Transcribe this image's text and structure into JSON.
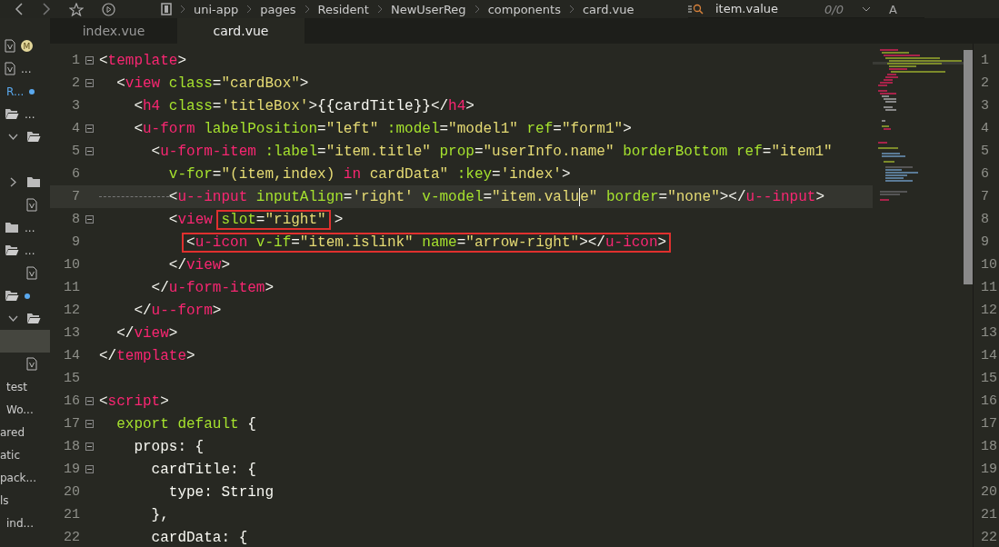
{
  "toolbar": {
    "breadcrumb": [
      "uni-app",
      "pages",
      "Resident",
      "NewUserReg",
      "components",
      "card.vue"
    ],
    "search": {
      "value": "item.value",
      "count": "0/0",
      "case_toggle": "A"
    }
  },
  "tabs": [
    {
      "label": "index.vue",
      "selected": false
    },
    {
      "label": "card.vue",
      "selected": true
    }
  ],
  "sidebar": {
    "items": [
      {
        "kind": "file",
        "badge": "M",
        "selected": false,
        "modified": false
      },
      {
        "kind": "file",
        "label": "...",
        "selected": false,
        "modified": false
      },
      {
        "kind": "label",
        "label": "R...",
        "selected": false,
        "modified": true
      },
      {
        "kind": "open-folder",
        "label": "...",
        "selected": false,
        "modified": false
      },
      {
        "kind": "expanded-folder",
        "selected": false,
        "modified": false
      },
      {
        "kind": "blank",
        "selected": false
      },
      {
        "kind": "collapsed-folder",
        "selected": false,
        "modified": false
      },
      {
        "kind": "nested-file",
        "selected": false,
        "modified": false
      },
      {
        "kind": "folder",
        "label": "...",
        "selected": false,
        "modified": false
      },
      {
        "kind": "open-folder",
        "label": "...",
        "selected": false,
        "modified": false
      },
      {
        "kind": "nested-file",
        "selected": false,
        "modified": false
      },
      {
        "kind": "open-folder",
        "selected": false,
        "modified": true
      },
      {
        "kind": "expanded-folder",
        "selected": false,
        "modified": false
      },
      {
        "kind": "blank",
        "selected": true
      },
      {
        "kind": "nested-file",
        "selected": false,
        "modified": false
      },
      {
        "kind": "text",
        "label": "test",
        "selected": false
      },
      {
        "kind": "text",
        "label": "Wo...",
        "selected": false
      },
      {
        "kind": "cut-text",
        "label": "ared",
        "selected": false
      },
      {
        "kind": "cut-text",
        "label": "atic",
        "selected": false
      },
      {
        "kind": "cut-text",
        "label": "pack...",
        "selected": false
      },
      {
        "kind": "cut-text",
        "label": "ls",
        "selected": false
      },
      {
        "kind": "text",
        "label": "ind...",
        "selected": false
      }
    ]
  },
  "editor": {
    "lines": [
      {
        "number": "1",
        "fold": true,
        "current": false,
        "tokens": [
          {
            "kind": "punct",
            "text": "<"
          },
          {
            "kind": "tag",
            "text": "template"
          },
          {
            "kind": "punct",
            "text": ">"
          }
        ]
      },
      {
        "number": "2",
        "fold": true,
        "current": false,
        "tokens": [
          {
            "kind": "punct",
            "text": "  <"
          },
          {
            "kind": "tag",
            "text": "view"
          },
          {
            "kind": "attr",
            "text": " class"
          },
          {
            "kind": "punct",
            "text": "="
          },
          {
            "kind": "string",
            "text": "\"cardBox\""
          },
          {
            "kind": "punct",
            "text": ">"
          }
        ]
      },
      {
        "number": "3",
        "fold": false,
        "current": false,
        "tokens": [
          {
            "kind": "punct",
            "text": "    <"
          },
          {
            "kind": "tag",
            "text": "h4"
          },
          {
            "kind": "attr",
            "text": " class"
          },
          {
            "kind": "punct",
            "text": "="
          },
          {
            "kind": "string",
            "text": "'titleBox'"
          },
          {
            "kind": "punct",
            "text": ">{{cardTitle}}</"
          },
          {
            "kind": "tag",
            "text": "h4"
          },
          {
            "kind": "punct",
            "text": ">"
          }
        ]
      },
      {
        "number": "4",
        "fold": true,
        "current": false,
        "tokens": [
          {
            "kind": "punct",
            "text": "    <"
          },
          {
            "kind": "tag",
            "text": "u-form"
          },
          {
            "kind": "attr",
            "text": " labelPosition"
          },
          {
            "kind": "punct",
            "text": "="
          },
          {
            "kind": "string",
            "text": "\"left\""
          },
          {
            "kind": "attr",
            "text": " :model"
          },
          {
            "kind": "punct",
            "text": "="
          },
          {
            "kind": "string",
            "text": "\"model1\""
          },
          {
            "kind": "attr",
            "text": " ref"
          },
          {
            "kind": "punct",
            "text": "="
          },
          {
            "kind": "string",
            "text": "\"form1\""
          },
          {
            "kind": "punct",
            "text": ">"
          }
        ]
      },
      {
        "number": "5",
        "fold": true,
        "current": false,
        "tokens": [
          {
            "kind": "punct",
            "text": "      <"
          },
          {
            "kind": "tag",
            "text": "u-form-item"
          },
          {
            "kind": "attr",
            "text": " :label"
          },
          {
            "kind": "punct",
            "text": "="
          },
          {
            "kind": "string",
            "text": "\"item.title\""
          },
          {
            "kind": "attr",
            "text": " prop"
          },
          {
            "kind": "punct",
            "text": "="
          },
          {
            "kind": "string",
            "text": "\"userInfo.name\""
          },
          {
            "kind": "attr",
            "text": " borderBottom ref"
          },
          {
            "kind": "punct",
            "text": "="
          },
          {
            "kind": "string",
            "text": "\"item1\""
          }
        ]
      },
      {
        "number": "6",
        "fold": false,
        "current": false,
        "tokens": [
          {
            "kind": "attr",
            "text": "        v-for"
          },
          {
            "kind": "punct",
            "text": "="
          },
          {
            "kind": "string",
            "text": "\"(item,index) "
          },
          {
            "kind": "keyword",
            "text": "in"
          },
          {
            "kind": "string",
            "text": " cardData\""
          },
          {
            "kind": "attr",
            "text": " :key"
          },
          {
            "kind": "punct",
            "text": "="
          },
          {
            "kind": "string",
            "text": "'index'"
          },
          {
            "kind": "punct",
            "text": ">"
          }
        ]
      },
      {
        "number": "7",
        "fold": false,
        "current": true,
        "tokens": [
          {
            "kind": "punct",
            "text": "        <"
          },
          {
            "kind": "tag",
            "text": "u--input"
          },
          {
            "kind": "attr",
            "text": " inputAlign"
          },
          {
            "kind": "punct",
            "text": "="
          },
          {
            "kind": "string",
            "text": "'right'"
          },
          {
            "kind": "attr",
            "text": " v-model"
          },
          {
            "kind": "punct",
            "text": "="
          },
          {
            "kind": "string",
            "text": "\"item.valu"
          },
          {
            "kind": "caret"
          },
          {
            "kind": "string",
            "text": "e\""
          },
          {
            "kind": "attr",
            "text": " border"
          },
          {
            "kind": "punct",
            "text": "="
          },
          {
            "kind": "string",
            "text": "\"none\""
          },
          {
            "kind": "punct",
            "text": "></"
          },
          {
            "kind": "tag",
            "text": "u--input"
          },
          {
            "kind": "punct",
            "text": ">"
          }
        ]
      },
      {
        "number": "8",
        "fold": true,
        "current": false,
        "tokens": [
          {
            "kind": "punct",
            "text": "        <"
          },
          {
            "kind": "tag",
            "text": "view "
          },
          {
            "kind": "box",
            "tokens": [
              {
                "kind": "attr",
                "text": "slot"
              },
              {
                "kind": "punct",
                "text": "="
              },
              {
                "kind": "string",
                "text": "\"right\""
              }
            ]
          },
          {
            "kind": "punct",
            "text": ">"
          }
        ]
      },
      {
        "number": "9",
        "fold": false,
        "current": false,
        "tokens": [
          {
            "kind": "box",
            "tokens": [
              {
                "kind": "punct",
                "text": "          <"
              },
              {
                "kind": "tag",
                "text": "u-icon"
              },
              {
                "kind": "attr",
                "text": " v-if"
              },
              {
                "kind": "punct",
                "text": "="
              },
              {
                "kind": "string",
                "text": "\"item.islink\""
              },
              {
                "kind": "attr",
                "text": " name"
              },
              {
                "kind": "punct",
                "text": "="
              },
              {
                "kind": "string",
                "text": "\"arrow-right\""
              },
              {
                "kind": "punct",
                "text": "></"
              },
              {
                "kind": "tag",
                "text": "u-icon"
              },
              {
                "kind": "punct",
                "text": ">"
              }
            ]
          }
        ]
      },
      {
        "number": "10",
        "fold": false,
        "current": false,
        "tokens": [
          {
            "kind": "punct",
            "text": "        </"
          },
          {
            "kind": "tag",
            "text": "view"
          },
          {
            "kind": "punct",
            "text": ">"
          }
        ]
      },
      {
        "number": "11",
        "fold": false,
        "current": false,
        "tokens": [
          {
            "kind": "punct",
            "text": "      </"
          },
          {
            "kind": "tag",
            "text": "u-form-item"
          },
          {
            "kind": "punct",
            "text": ">"
          }
        ]
      },
      {
        "number": "12",
        "fold": false,
        "current": false,
        "tokens": [
          {
            "kind": "punct",
            "text": "    </"
          },
          {
            "kind": "tag",
            "text": "u--form"
          },
          {
            "kind": "punct",
            "text": ">"
          }
        ]
      },
      {
        "number": "13",
        "fold": false,
        "current": false,
        "tokens": [
          {
            "kind": "punct",
            "text": "  </"
          },
          {
            "kind": "tag",
            "text": "view"
          },
          {
            "kind": "punct",
            "text": ">"
          }
        ]
      },
      {
        "number": "14",
        "fold": false,
        "current": false,
        "tokens": [
          {
            "kind": "punct",
            "text": "</"
          },
          {
            "kind": "tag",
            "text": "template"
          },
          {
            "kind": "punct",
            "text": ">"
          }
        ]
      },
      {
        "number": "15",
        "fold": false,
        "current": false
      },
      {
        "number": "16",
        "fold": true,
        "current": false,
        "tokens": [
          {
            "kind": "punct",
            "text": "<"
          },
          {
            "kind": "tag",
            "text": "script"
          },
          {
            "kind": "punct",
            "text": ">"
          }
        ]
      },
      {
        "number": "17",
        "fold": true,
        "current": false,
        "tokens": [
          {
            "kind": "keyword2",
            "text": "  export default"
          },
          {
            "kind": "punct",
            "text": " {"
          }
        ]
      },
      {
        "number": "18",
        "fold": true,
        "current": false,
        "tokens": [
          {
            "kind": "punct",
            "text": "    props: {"
          }
        ]
      },
      {
        "number": "19",
        "fold": true,
        "current": false,
        "tokens": [
          {
            "kind": "punct",
            "text": "      cardTitle: {"
          }
        ]
      },
      {
        "number": "20",
        "fold": false,
        "current": false,
        "tokens": [
          {
            "kind": "punct",
            "text": "        type: String"
          }
        ]
      },
      {
        "number": "21",
        "fold": false,
        "current": false,
        "tokens": [
          {
            "kind": "punct",
            "text": "      },"
          }
        ]
      },
      {
        "number": "22",
        "fold": false,
        "current": false,
        "tokens": [
          {
            "kind": "punct",
            "text": "      cardData: {"
          }
        ]
      }
    ]
  },
  "split_pane": {
    "line_numbers": [
      "1",
      "2",
      "3",
      "4",
      "5",
      "6",
      "7",
      "8",
      "9",
      "10",
      "11",
      "12",
      "13",
      "14",
      "15",
      "16",
      "17",
      "18",
      "19",
      "20",
      "21",
      "22"
    ]
  }
}
